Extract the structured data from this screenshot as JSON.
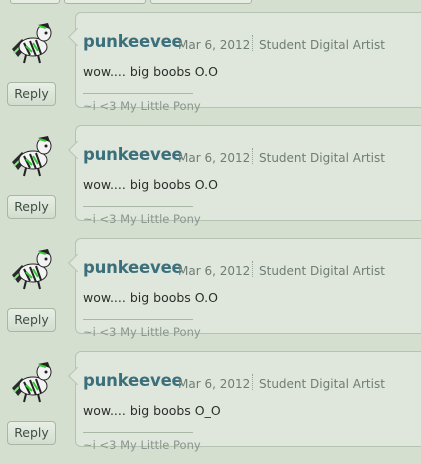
{
  "comments": [
    {
      "username": "punkeevee",
      "date": "Mar 6, 2012",
      "role": "Student Digital Artist",
      "message": "wow.... big boobs O.O",
      "signature": "~i <3 My Little Pony",
      "reply_label": "Reply",
      "avatar_icon": "zebra-pony-icon"
    },
    {
      "username": "punkeevee",
      "date": "Mar 6, 2012",
      "role": "Student Digital Artist",
      "message": "wow.... big boobs O.O",
      "signature": "~i <3 My Little Pony",
      "reply_label": "Reply",
      "avatar_icon": "zebra-pony-icon"
    },
    {
      "username": "punkeevee",
      "date": "Mar 6, 2012",
      "role": "Student Digital Artist",
      "message": "wow.... big boobs O.O",
      "signature": "~i <3 My Little Pony",
      "reply_label": "Reply",
      "avatar_icon": "zebra-pony-icon"
    },
    {
      "username": "punkeevee",
      "date": "Mar 6, 2012",
      "role": "Student Digital Artist",
      "message": "wow.... big boobs O_O",
      "signature": "~i <3 My Little Pony",
      "reply_label": "Reply",
      "avatar_icon": "zebra-pony-icon"
    }
  ],
  "colors": {
    "background": "#d5dfd0",
    "username": "#3b6f7b",
    "avatar_green": "#33cc33"
  }
}
